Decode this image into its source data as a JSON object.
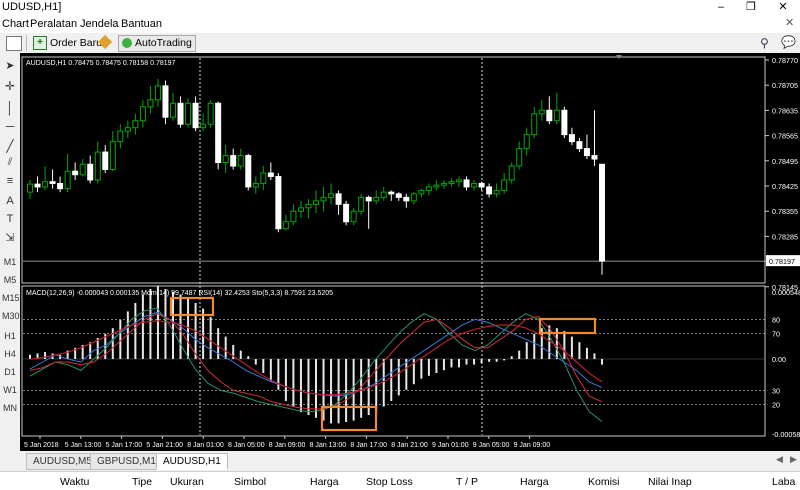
{
  "window": {
    "title": "UDUSD,H1]",
    "min": "–",
    "restore": "❐",
    "close": "✕"
  },
  "menu": [
    "Chart",
    "Peralatan",
    "Jendela",
    "Bantuan"
  ],
  "toolbar": {
    "order_label": "Order Baru",
    "autotrading_label": "AutoTrading"
  },
  "left_tools": [
    "M1",
    "M5",
    "M15",
    "M30",
    "H1",
    "H4",
    "D1",
    "W1",
    "MN"
  ],
  "chart": {
    "info": "AUDUSD,H1  0.78475 0.78475 0.78158 0.78197",
    "indicators": "MACD(12,26,9) -0.000043 0.000135  Mom(14) 99.7487  RSI(14) 32.4253  Sto(5,3,3) 8.7591 23.5205",
    "price_axis": [
      "0.78770",
      "0.78705",
      "0.78635",
      "0.78565",
      "0.78495",
      "0.78425",
      "0.78355",
      "0.78285",
      "0.78215",
      "0.78145"
    ],
    "current_price": "0.78197",
    "sub_axis": [
      "0.000548",
      "80",
      "70",
      "0.00",
      "30",
      "20",
      "-0.000586"
    ],
    "time_axis": [
      "5 Jan 2018",
      "5 Jan 13:00",
      "5 Jan 17:00",
      "5 Jan 21:00",
      "8 Jan 01:00",
      "8 Jan 05:00",
      "8 Jan 09:00",
      "8 Jan 13:00",
      "8 Jan 17:00",
      "8 Jan 21:00",
      "9 Jan 01:00",
      "9 Jan 05:00",
      "9 Jan 09:00"
    ],
    "colors": {
      "bull": "#00aa00",
      "bear": "#ffffff",
      "bg": "#000000",
      "highlight": "#f08a2a"
    }
  },
  "tabs": [
    "AUDUSD,M5",
    "GBPUSD,M1",
    "AUDUSD,H1"
  ],
  "columns": [
    "Waktu",
    "Tipe",
    "Ukuran",
    "Simbol",
    "Harga",
    "Stop Loss",
    "T / P",
    "Harga",
    "Komisi",
    "Nilai Inap",
    "Laba"
  ],
  "candles": [
    [
      0.78395,
      0.78418,
      0.78375,
      0.7843
    ],
    [
      0.78418,
      0.7841,
      0.78395,
      0.7844
    ],
    [
      0.7841,
      0.78425,
      0.784,
      0.7847
    ],
    [
      0.78425,
      0.7842,
      0.78405,
      0.7846
    ],
    [
      0.7842,
      0.78405,
      0.78395,
      0.7844
    ],
    [
      0.78405,
      0.78455,
      0.78395,
      0.78505
    ],
    [
      0.78455,
      0.78445,
      0.7843,
      0.7848
    ],
    [
      0.78445,
      0.78475,
      0.7844,
      0.7849
    ],
    [
      0.78475,
      0.7843,
      0.7842,
      0.785
    ],
    [
      0.7843,
      0.7851,
      0.7842,
      0.7854
    ],
    [
      0.7851,
      0.7846,
      0.7845,
      0.7853
    ],
    [
      0.7846,
      0.7854,
      0.78455,
      0.7857
    ],
    [
      0.7854,
      0.7857,
      0.7852,
      0.7859
    ],
    [
      0.7857,
      0.7858,
      0.7855,
      0.786
    ],
    [
      0.7858,
      0.786,
      0.7856,
      0.7862
    ],
    [
      0.786,
      0.7864,
      0.7858,
      0.7866
    ],
    [
      0.7864,
      0.7866,
      0.7862,
      0.787
    ],
    [
      0.7866,
      0.787,
      0.7864,
      0.7872
    ],
    [
      0.787,
      0.7861,
      0.7859,
      0.78715
    ],
    [
      0.7861,
      0.7865,
      0.786,
      0.7868
    ],
    [
      0.7865,
      0.7859,
      0.7858,
      0.7867
    ],
    [
      0.7859,
      0.7865,
      0.7858,
      0.78665
    ],
    [
      0.7865,
      0.7858,
      0.7857,
      0.7867
    ],
    [
      0.7858,
      0.7859,
      0.7857,
      0.7862
    ],
    [
      0.7859,
      0.7865,
      0.7858,
      0.7866
    ],
    [
      0.7865,
      0.7848,
      0.7846,
      0.78655
    ],
    [
      0.7848,
      0.785,
      0.7845,
      0.7853
    ],
    [
      0.785,
      0.7847,
      0.7846,
      0.7852
    ],
    [
      0.7847,
      0.785,
      0.7846,
      0.7852
    ],
    [
      0.785,
      0.7841,
      0.784,
      0.78505
    ],
    [
      0.7841,
      0.7842,
      0.7839,
      0.7844
    ],
    [
      0.7842,
      0.7845,
      0.784,
      0.7847
    ],
    [
      0.7845,
      0.7844,
      0.7843,
      0.7848
    ],
    [
      0.7844,
      0.7829,
      0.7828,
      0.7845
    ],
    [
      0.7829,
      0.7831,
      0.78285,
      0.7833
    ],
    [
      0.7831,
      0.7834,
      0.783,
      0.7836
    ],
    [
      0.7834,
      0.7835,
      0.7832,
      0.7837
    ],
    [
      0.7835,
      0.7836,
      0.7832,
      0.78375
    ],
    [
      0.7836,
      0.7837,
      0.78335,
      0.784
    ],
    [
      0.7837,
      0.7838,
      0.7834,
      0.7841
    ],
    [
      0.7838,
      0.7839,
      0.7836,
      0.7842
    ],
    [
      0.7839,
      0.7836,
      0.7833,
      0.784
    ],
    [
      0.7836,
      0.7831,
      0.783,
      0.7837
    ],
    [
      0.7831,
      0.7834,
      0.783,
      0.7835
    ],
    [
      0.7834,
      0.7838,
      0.7833,
      0.7839
    ],
    [
      0.7838,
      0.7837,
      0.7829,
      0.78385
    ],
    [
      0.7837,
      0.7838,
      0.7836,
      0.784
    ],
    [
      0.7838,
      0.78395,
      0.7837,
      0.7841
    ],
    [
      0.78395,
      0.7839,
      0.7837,
      0.784
    ],
    [
      0.7839,
      0.7838,
      0.7837,
      0.78395
    ],
    [
      0.7838,
      0.7837,
      0.7835,
      0.7839
    ],
    [
      0.7837,
      0.7839,
      0.7836,
      0.78395
    ],
    [
      0.7839,
      0.784,
      0.7838,
      0.78405
    ],
    [
      0.784,
      0.7841,
      0.78385,
      0.7842
    ],
    [
      0.7841,
      0.78415,
      0.784,
      0.7843
    ],
    [
      0.78415,
      0.7842,
      0.78405,
      0.7843
    ],
    [
      0.7842,
      0.78425,
      0.7841,
      0.78435
    ],
    [
      0.78425,
      0.7843,
      0.7841,
      0.7844
    ],
    [
      0.7843,
      0.7841,
      0.784,
      0.7844
    ],
    [
      0.7841,
      0.7842,
      0.784,
      0.7843
    ],
    [
      0.7842,
      0.7841,
      0.784,
      0.78425
    ],
    [
      0.7841,
      0.7839,
      0.7838,
      0.7842
    ],
    [
      0.7839,
      0.784,
      0.7838,
      0.7842
    ],
    [
      0.784,
      0.7843,
      0.7839,
      0.7845
    ],
    [
      0.7843,
      0.7847,
      0.7842,
      0.7848
    ],
    [
      0.7847,
      0.7852,
      0.7846,
      0.7854
    ],
    [
      0.7852,
      0.7856,
      0.785,
      0.7858
    ],
    [
      0.7856,
      0.7862,
      0.7855,
      0.7864
    ],
    [
      0.7862,
      0.7863,
      0.786,
      0.7866
    ],
    [
      0.7863,
      0.786,
      0.7859,
      0.7867
    ],
    [
      0.786,
      0.7863,
      0.7859,
      0.7868
    ],
    [
      0.7863,
      0.7856,
      0.7855,
      0.7864
    ],
    [
      0.7856,
      0.7854,
      0.7853,
      0.7858
    ],
    [
      0.7854,
      0.7852,
      0.7851,
      0.7855
    ],
    [
      0.7852,
      0.785,
      0.7849,
      0.7856
    ],
    [
      0.785,
      0.7849,
      0.7847,
      0.7863
    ],
    [
      0.78475,
      0.78197,
      0.78158,
      0.78475
    ]
  ],
  "macd": [
    3e-05,
    4e-05,
    5e-05,
    4e-05,
    3e-05,
    6e-05,
    8e-05,
    0.0001,
    0.00012,
    0.00015,
    0.00018,
    0.00022,
    0.00028,
    0.00034,
    0.0004,
    0.00046,
    0.0005,
    0.00052,
    0.0005,
    0.00048,
    0.00046,
    0.00044,
    0.0004,
    0.00036,
    0.0003,
    0.00022,
    0.00016,
    0.0001,
    6e-05,
    2e-05,
    -4e-05,
    -0.0001,
    -0.00016,
    -0.00022,
    -0.0003,
    -0.00034,
    -0.00038,
    -0.0004,
    -0.00042,
    -0.00044,
    -0.00046,
    -0.00046,
    -0.00045,
    -0.00044,
    -0.00042,
    -0.0004,
    -0.00038,
    -0.00034,
    -0.0003,
    -0.00026,
    -0.00022,
    -0.00018,
    -0.00014,
    -0.00012,
    -0.0001,
    -8e-05,
    -6e-05,
    -6e-05,
    -4e-05,
    -4e-05,
    -3e-05,
    -2e-05,
    -2e-05,
    -1e-05,
    2e-05,
    6e-05,
    0.00012,
    0.00018,
    0.00022,
    0.00024,
    0.00022,
    0.0002,
    0.00016,
    0.00012,
    8e-05,
    4e-05,
    -4e-05
  ]
}
